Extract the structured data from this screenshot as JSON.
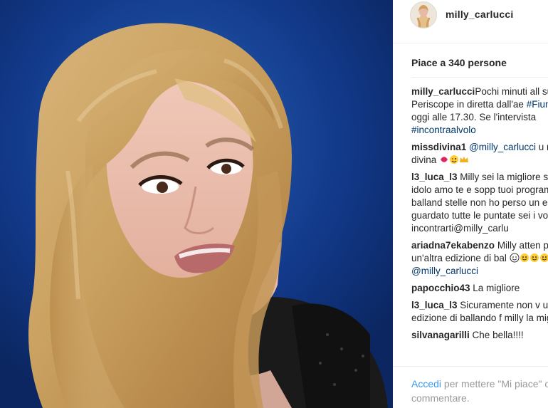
{
  "post": {
    "username": "milly_carlucci",
    "likes_text": "Piace a 340 persone"
  },
  "comments": [
    {
      "user": "milly_carlucci",
      "parts": [
        {
          "t": "Pochi minuti all"
        },
        {
          "t": " su Periscope in diretta dall'ae"
        },
        {
          "t": " "
        },
        {
          "t": "#Fiumicino",
          "tag": true
        },
        {
          "t": " oggi alle 17.30. Se"
        },
        {
          "t": " l'intervista "
        },
        {
          "t": "#incontraalvolo",
          "tag": true
        }
      ]
    },
    {
      "user": "missdivina1",
      "parts": [
        {
          "t": " "
        },
        {
          "t": "@milly_carlucci",
          "tag": true
        },
        {
          "t": " u"
        },
        {
          "t": " miss divina "
        },
        {
          "emoji": [
            "kiss-emoji",
            "wink-emoji",
            "crown-emoji"
          ]
        }
      ]
    },
    {
      "user": "l3_luca_l3",
      "parts": [
        {
          "t": " Milly sei la migliore"
        },
        {
          "t": " sei il mio idolo amo te e sopp"
        },
        {
          "t": " tuoi programmi come balland"
        },
        {
          "t": " stelle non ho perso un edizion"
        },
        {
          "t": " guardato tutte le puntate sei i"
        },
        {
          "t": " vorrei incontrarti@milly_carlu"
        }
      ]
    },
    {
      "user": "ariadna7ekabenzo",
      "parts": [
        {
          "t": " Milly atten"
        },
        {
          "t": " presto un'altra edizione di bal"
        },
        {
          "t": " "
        },
        {
          "emoji": [
            "smile-outline-emoji",
            "smile-emoji",
            "smile-emoji",
            "smile-emoji"
          ]
        },
        {
          "t": " "
        },
        {
          "t": "@milly_carlucci",
          "tag": true
        }
      ]
    },
    {
      "user": "papocchio43",
      "parts": [
        {
          "t": " La migliore"
        }
      ]
    },
    {
      "user": "l3_luca_l3",
      "parts": [
        {
          "t": " Sicuramente non v"
        },
        {
          "t": " un altra edizione di ballando f"
        },
        {
          "t": " milly la migliore"
        }
      ]
    },
    {
      "user": "silvanagarilli",
      "parts": [
        {
          "t": " Che bella!!!!"
        }
      ]
    }
  ],
  "footer": {
    "login_link": "Accedi",
    "rest": " per mettere \"Mi piace\" o commentare."
  },
  "colors": {
    "photo_bg": "#123a86",
    "hashtag": "#003569",
    "login": "#3897f0"
  }
}
